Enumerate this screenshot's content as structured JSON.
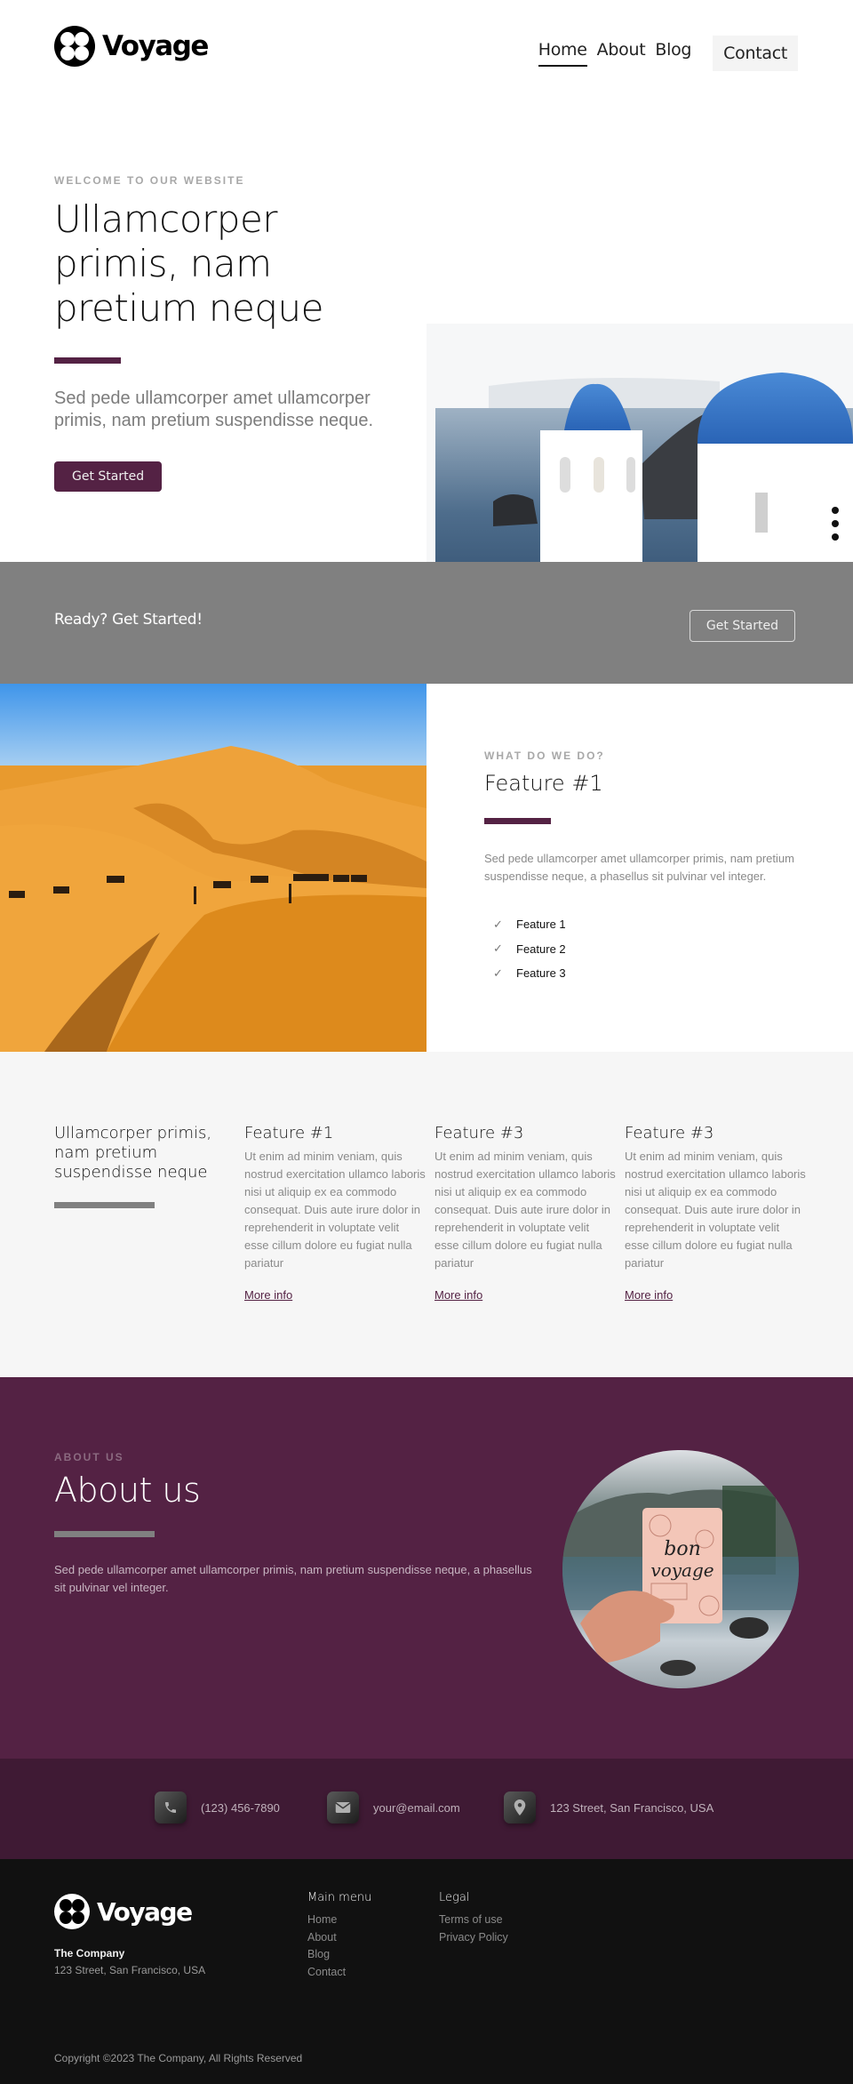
{
  "brand": {
    "name": "Voyage",
    "accent_color": "#542244"
  },
  "nav": {
    "items": [
      {
        "label": "Home",
        "active": true
      },
      {
        "label": "About",
        "active": false
      },
      {
        "label": "Blog",
        "active": false
      }
    ],
    "contact_label": "Contact"
  },
  "hero": {
    "eyebrow": "WELCOME TO OUR WEBSITE",
    "title": "Ullamcorper primis, nam pretium neque",
    "subtitle": "Sed pede ullamcorper amet ullamcorper primis, nam pretium suspendisse neque.",
    "button_label": "Get Started",
    "image_alt": "Santorini blue-domed church overlooking the sea"
  },
  "cta": {
    "text": "Ready? Get Started!",
    "button_label": "Get Started"
  },
  "feature": {
    "image_alt": "Camel caravan crossing desert dunes",
    "eyebrow": "WHAT DO WE DO?",
    "title": "Feature #1",
    "text": "Sed pede ullamcorper amet ullamcorper primis, nam pretium suspendisse neque, a phasellus sit pulvinar vel integer.",
    "checklist": [
      "Feature 1",
      "Feature 2",
      "Feature 3"
    ]
  },
  "columns": {
    "intro_title": "Ullamcorper primis, nam pretium suspendisse neque",
    "items": [
      {
        "title": "Feature #1",
        "text": "Ut enim ad minim veniam, quis nostrud exercitation ullamco laboris nisi ut aliquip ex ea commodo consequat. Duis aute irure dolor in reprehenderit in voluptate velit esse cillum dolore eu fugiat nulla pariatur",
        "link": "More info"
      },
      {
        "title": "Feature #3",
        "text": "Ut enim ad minim veniam, quis nostrud exercitation ullamco laboris nisi ut aliquip ex ea commodo consequat. Duis aute irure dolor in reprehenderit in voluptate velit esse cillum dolore eu fugiat nulla pariatur",
        "link": "More info"
      },
      {
        "title": "Feature #3",
        "text": "Ut enim ad minim veniam, quis nostrud exercitation ullamco laboris nisi ut aliquip ex ea commodo consequat. Duis aute irure dolor in reprehenderit in voluptate velit esse cillum dolore eu fugiat nulla pariatur",
        "link": "More info"
      }
    ]
  },
  "about": {
    "eyebrow": "ABOUT US",
    "title": "About us",
    "text": "Sed pede ullamcorper amet ullamcorper primis, nam pretium suspendisse neque, a phasellus sit pulvinar vel integer.",
    "image_alt": "Hand holding a bon voyage passport cover by a lake",
    "image_caption": "bon voyage"
  },
  "contact": {
    "phone": "(123) 456-7890",
    "email": "your@email.com",
    "address": "123 Street, San Francisco, USA"
  },
  "footer": {
    "company_name": "The Company",
    "company_address": "123 Street, San Francisco, USA",
    "main_menu": {
      "title": "Main menu",
      "links": [
        "Home",
        "About",
        "Blog",
        "Contact"
      ]
    },
    "legal": {
      "title": "Legal",
      "links": [
        "Terms of use",
        "Privacy Policy"
      ]
    },
    "copyright": "Copyright ©2023 The Company, All Rights Reserved"
  }
}
